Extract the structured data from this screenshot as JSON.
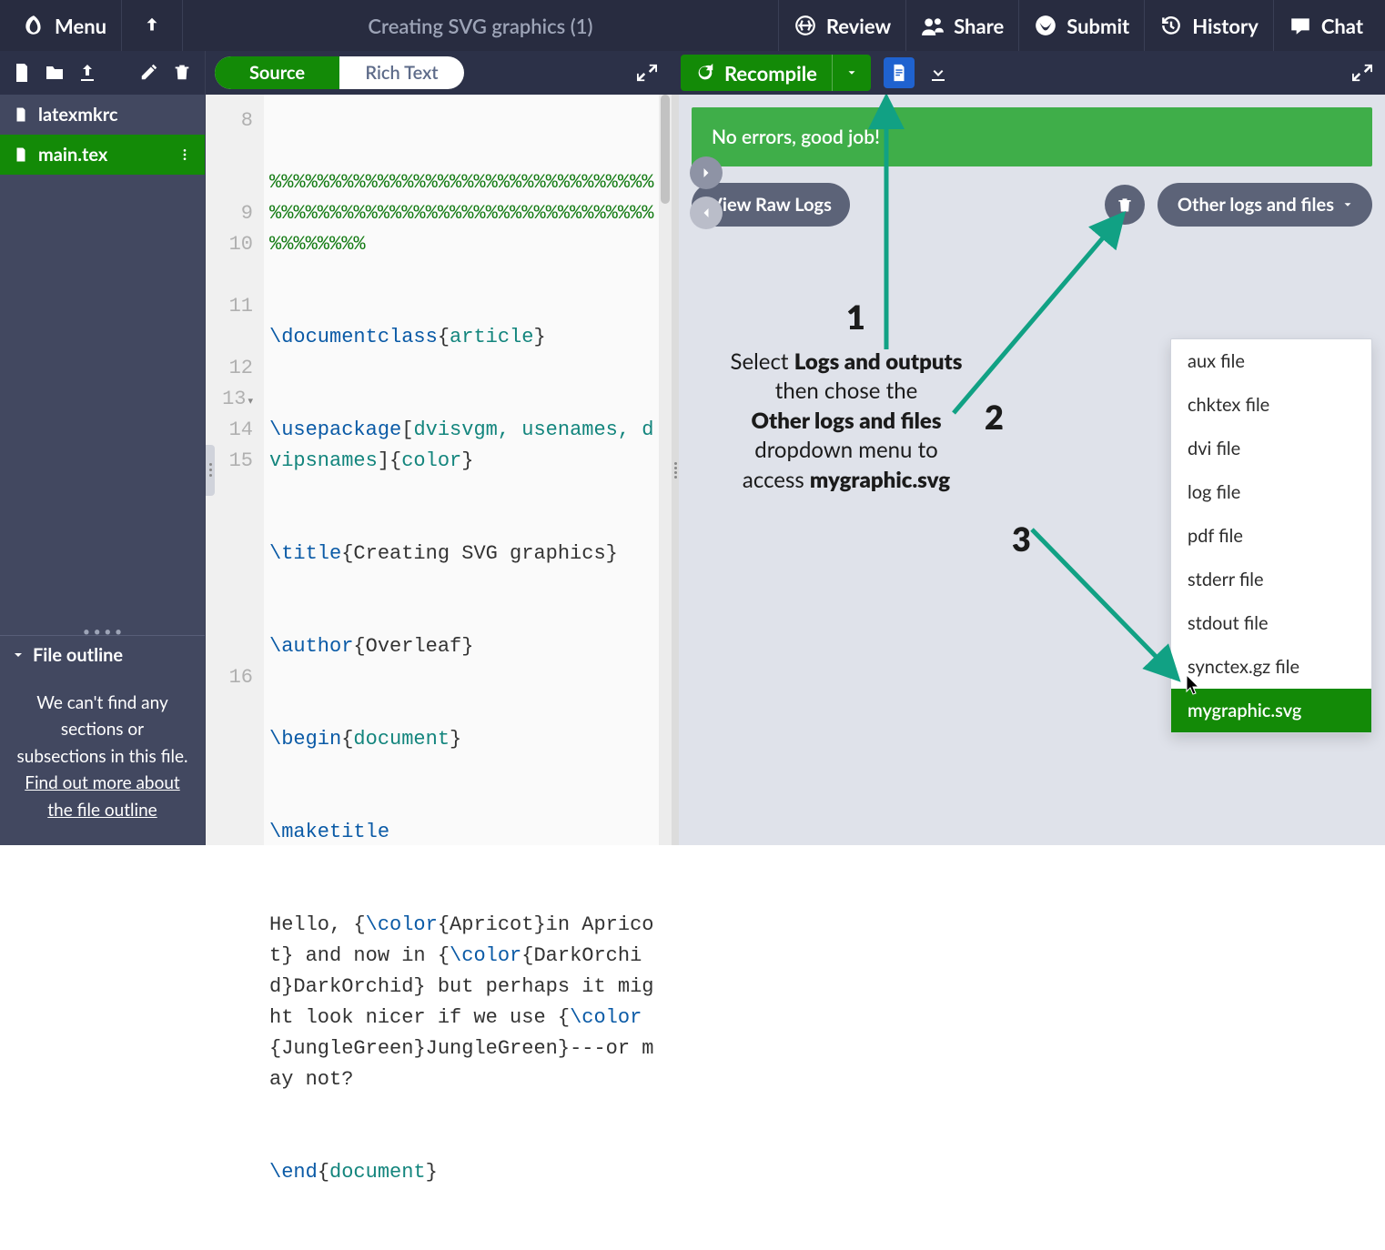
{
  "topbar": {
    "menu": "Menu",
    "title": "Creating SVG graphics (1)",
    "review": "Review",
    "share": "Share",
    "submit": "Submit",
    "history": "History",
    "chat": "Chat"
  },
  "row2": {
    "source": "Source",
    "richtext": "Rich Text",
    "recompile": "Recompile"
  },
  "files": {
    "item0": "latexmkrc",
    "item1": "main.tex"
  },
  "outline": {
    "title": "File outline",
    "msg1": "We can't find any sections or subsections in this file.",
    "link": "Find out more about the file outline"
  },
  "editor": {
    "gutter": {
      "l0": "8",
      "l1": "9",
      "l2": "10",
      "l3": "11",
      "l4": "12",
      "l5": "13",
      "l6": "14",
      "l7": "15",
      "l8": "16"
    }
  },
  "code": {
    "pct_row": "%%%%%%%%%%%%%%%%%%%%%%%%%%%%%%%%%%%%%%%%%%%%%%%%%%%%%%%%%%%%%%%%%%%%%%%%",
    "documentclass": "\\documentclass",
    "article": "article",
    "usepackage": "\\usepackage",
    "usepackage_opts": "dvisvgm, usenames, dvipsnames",
    "color": "color",
    "title_cmd": "\\title",
    "title_text": "Creating SVG graphics",
    "author_cmd": "\\author",
    "author_text": "Overleaf",
    "begin": "\\begin",
    "document": "document",
    "maketitle": "\\maketitle",
    "hello_pre": "Hello, {",
    "color_cmd": "\\color",
    "apricot": "Apricot",
    "l15_b": "in Apricot} and now in {",
    "darkorchid": "DarkOrchid",
    "l15_c": "DarkOrchid} but perhaps it might look nicer if we use {",
    "junglegreen": "JungleGreen",
    "l15_d": "JungleGreen}---or may not?",
    "end": "\\end"
  },
  "preview": {
    "banner": "No errors, good job!",
    "view_raw": "View Raw Logs",
    "other_logs": "Other logs and files"
  },
  "dropdown": {
    "i0": "aux file",
    "i1": "chktex file",
    "i2": "dvi file",
    "i3": "log file",
    "i4": "pdf file",
    "i5": "stderr file",
    "i6": "stdout file",
    "i7": "synctex.gz file",
    "i8": "mygraphic.svg"
  },
  "anno": {
    "n1": "1",
    "n2": "2",
    "n3": "3",
    "line1a": "Select ",
    "line1b": "Logs and outputs",
    "line2": "then chose the",
    "line3": "Other logs and files",
    "line4": "dropdown menu to",
    "line5a": "access ",
    "line5b": "mygraphic.svg"
  }
}
